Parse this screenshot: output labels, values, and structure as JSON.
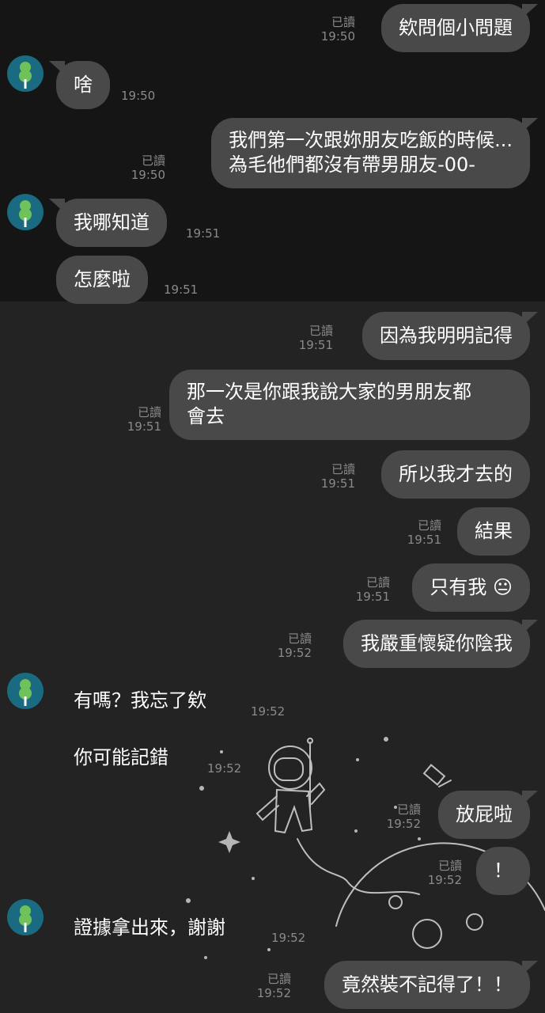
{
  "read_label": "已讀",
  "messages": [
    {
      "text": "欸問個小問題",
      "time": "19:50"
    },
    {
      "text": "啥",
      "time": "19:50"
    },
    {
      "line1": "我們第一次跟妳朋友吃飯的時候...",
      "line2": "為毛他們都沒有帶男朋友-00-",
      "time": "19:50"
    },
    {
      "text": "我哪知道",
      "time": "19:51"
    },
    {
      "text": "怎麼啦",
      "time": "19:51"
    },
    {
      "text": "因為我明明記得",
      "time": "19:51"
    },
    {
      "line1": "那一次是你跟我說大家的男朋友都",
      "line2": "會去",
      "time": "19:51"
    },
    {
      "text": "所以我才去的",
      "time": "19:51"
    },
    {
      "text": "結果",
      "time": "19:51"
    },
    {
      "text": "只有我",
      "emoji": "😐",
      "time": "19:51"
    },
    {
      "text": "我嚴重懷疑你陰我",
      "time": "19:52"
    },
    {
      "text": "有嗎？我忘了欸",
      "time": "19:52"
    },
    {
      "text": "你可能記錯",
      "time": "19:52"
    },
    {
      "text": "放屁啦",
      "time": "19:52"
    },
    {
      "text": "！",
      "time": "19:52"
    },
    {
      "text": "證據拿出來，謝謝",
      "time": "19:52"
    },
    {
      "text": "竟然裝不記得了！！",
      "time": "19:52"
    }
  ],
  "colors": {
    "bubble": "#494949",
    "avatar": "#1a6a82",
    "avatar_icon": "#6fc25a"
  },
  "icons": {
    "avatar": "tree-icon",
    "background": "astronaut-doodle"
  }
}
